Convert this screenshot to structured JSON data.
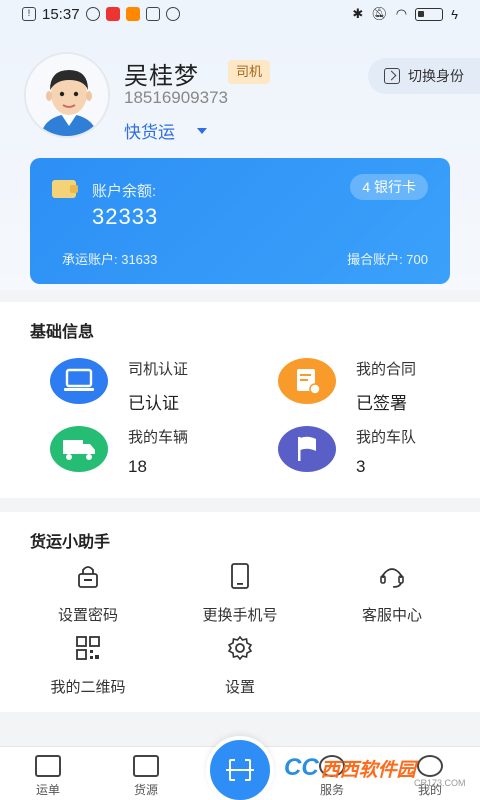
{
  "status_bar": {
    "time": "15:37"
  },
  "profile": {
    "name": "吴桂梦",
    "role": "司机",
    "phone": "18516909373",
    "company": "快货运",
    "switch_label": "切换身份"
  },
  "balance_card": {
    "balance_label": "账户余额:",
    "balance_value": "32333",
    "bank_cards": "4 银行卡",
    "carrier_account": "承运账户: 31633",
    "match_account": "撮合账户: 700"
  },
  "basic_info": {
    "title": "基础信息",
    "items": [
      {
        "label": "司机认证",
        "value": "已认证",
        "icon": "monitor-icon",
        "color": "#2d7cf2"
      },
      {
        "label": "我的合同",
        "value": "已签署",
        "icon": "contract-icon",
        "color": "#f89b2a"
      },
      {
        "label": "我的车辆",
        "value": "18",
        "icon": "truck-icon",
        "color": "#25bd73"
      },
      {
        "label": "我的车队",
        "value": "3",
        "icon": "flag-icon",
        "color": "#5a5fc8"
      }
    ]
  },
  "helper": {
    "title": "货运小助手",
    "items": [
      {
        "label": "设置密码",
        "icon": "lock-icon"
      },
      {
        "label": "更换手机号",
        "icon": "phone-icon"
      },
      {
        "label": "客服中心",
        "icon": "headset-icon"
      },
      {
        "label": "我的二维码",
        "icon": "qrcode-icon"
      },
      {
        "label": "设置",
        "icon": "gear-icon"
      }
    ]
  },
  "tab_bar": {
    "tabs": [
      {
        "label": "运单",
        "icon": "waybill-icon"
      },
      {
        "label": "货源",
        "icon": "cargo-box-icon"
      },
      {
        "label": "服务",
        "icon": "service-icon"
      },
      {
        "label": "我的",
        "icon": "profile-icon"
      }
    ],
    "scan_icon": "scan-icon"
  },
  "watermark": {
    "logo": "CC",
    "text": "西西软件园",
    "sub": "CR173.COM"
  }
}
